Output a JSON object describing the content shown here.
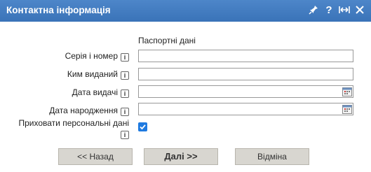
{
  "title": "Контактна інформація",
  "title_icons": [
    "pin-icon",
    "help-icon",
    "resize-icon",
    "close-icon"
  ],
  "title_help_glyph": "?",
  "section_title": "Паспортні дані",
  "info_glyph": "i",
  "fields": [
    {
      "label": "Серія і номер",
      "value": "",
      "has_calendar": false
    },
    {
      "label": "Ким виданий",
      "value": "",
      "has_calendar": false
    },
    {
      "label": "Дата видачі",
      "value": "",
      "has_calendar": true
    },
    {
      "label": "Дата народження",
      "value": "",
      "has_calendar": true
    }
  ],
  "hide_personal": {
    "label_line1": "Приховати персональні дані",
    "checked": true
  },
  "buttons": {
    "back": "<< Назад",
    "next": "Далі >>",
    "cancel": "Відміна"
  },
  "colors": {
    "titlebar": "#3f7abd",
    "checkbox": "#1f7ae0",
    "button_bg": "#d8d6d0"
  }
}
